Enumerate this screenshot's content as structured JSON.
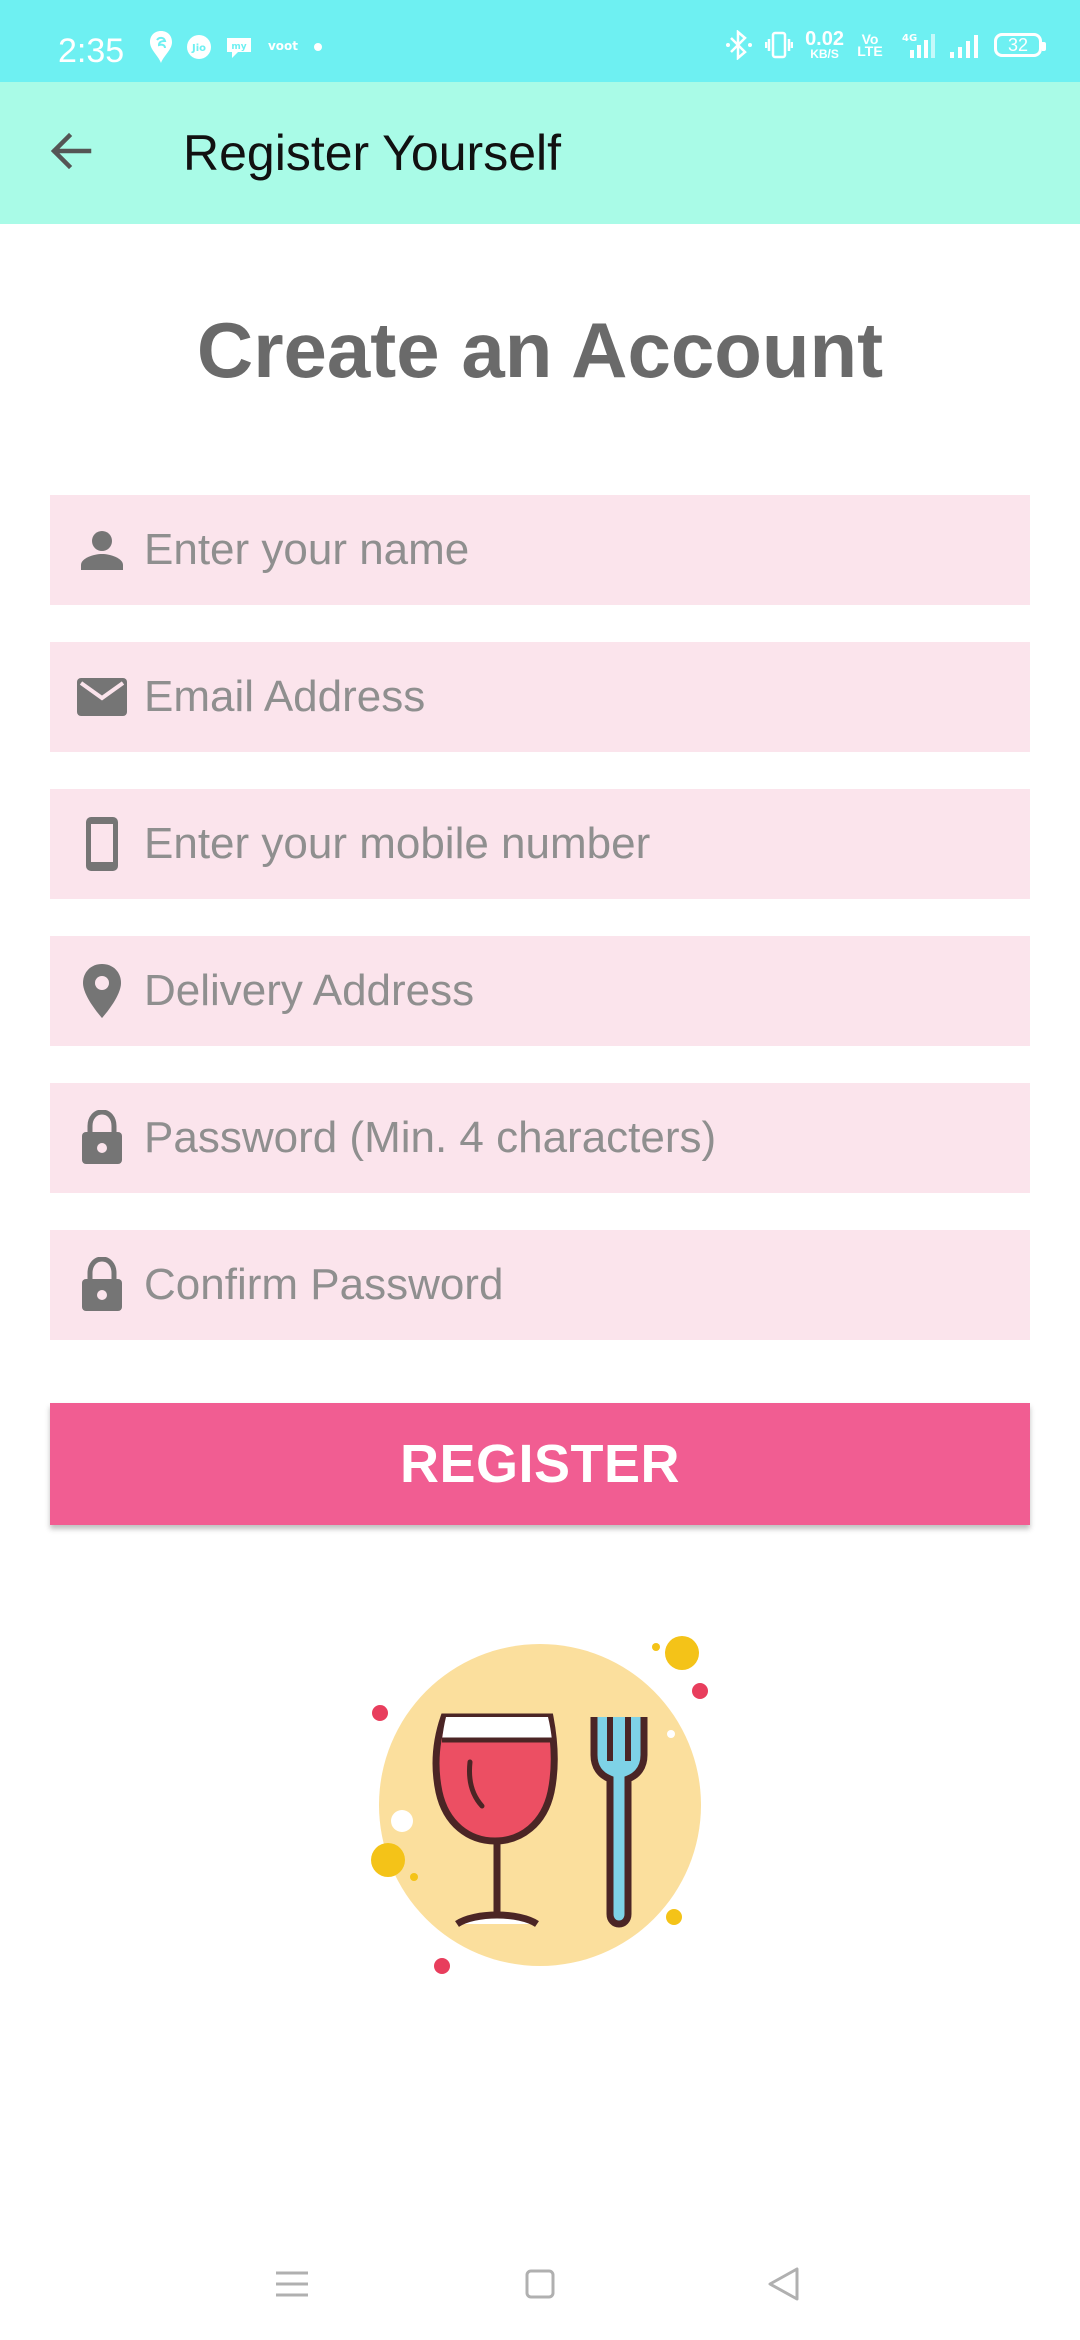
{
  "status_bar": {
    "time": "2:35",
    "left_icons": [
      "swiggy-icon",
      "jio-icon",
      "myjio-icon",
      "voot-icon",
      "dot-icon"
    ],
    "net_speed_value": "0.02",
    "net_speed_unit": "KB/S",
    "volte_label": "Vo LTE",
    "network_type": "4G",
    "battery_level": "32"
  },
  "app_bar": {
    "back_icon": "arrow-back-icon",
    "title": "Register Yourself"
  },
  "form": {
    "heading": "Create an Account",
    "fields": [
      {
        "name": "name-field",
        "icon": "person-icon",
        "placeholder": "Enter your name",
        "value": ""
      },
      {
        "name": "email-field",
        "icon": "email-icon",
        "placeholder": "Email Address",
        "value": ""
      },
      {
        "name": "mobile-field",
        "icon": "phone-icon",
        "placeholder": "Enter your mobile number",
        "value": ""
      },
      {
        "name": "address-field",
        "icon": "location-pin-icon",
        "placeholder": "Delivery Address",
        "value": ""
      },
      {
        "name": "password-field",
        "icon": "lock-icon",
        "placeholder": "Password (Min. 4 characters)",
        "value": ""
      },
      {
        "name": "confirm-password-field",
        "icon": "lock-icon",
        "placeholder": "Confirm Password",
        "value": ""
      }
    ],
    "register_label": "REGISTER"
  },
  "illustration": {
    "icon": "wine-glass-and-fork-icon"
  },
  "nav_bar": {
    "icons": [
      "menu-icon",
      "home-square-icon",
      "back-triangle-icon"
    ]
  },
  "colors": {
    "status_bar": "#6ef0f2",
    "app_bar": "#a9fbe7",
    "field_background": "#fbe4ec",
    "register_button": "#f15d92",
    "heading_text": "#6a6a6a",
    "icon_gray": "#757575"
  }
}
